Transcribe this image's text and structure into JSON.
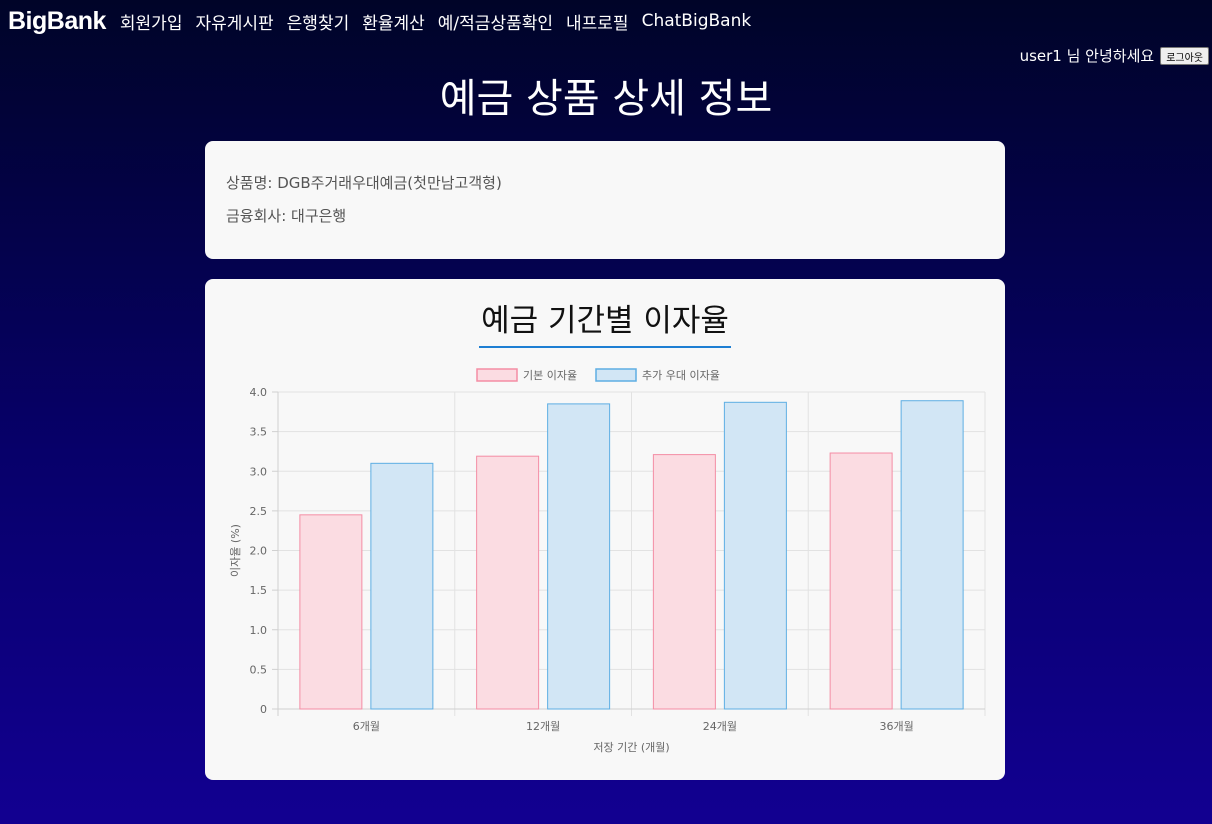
{
  "nav": {
    "logo": "BigBank",
    "items": [
      "회원가입",
      "자유게시판",
      "은행찾기",
      "환율계산",
      "예/적금상품확인",
      "내프로필",
      "ChatBigBank"
    ]
  },
  "user": {
    "greeting": "user1 님 안녕하세요",
    "logout_label": "로그아웃"
  },
  "page_title": "예금 상품 상세 정보",
  "product": {
    "name_line": "상품명: DGB주거래우대예금(첫만남고객형)",
    "company_line": "금융회사: 대구은행"
  },
  "chart_section_title": "예금 기간별 이자율",
  "chart_data": {
    "type": "bar",
    "categories": [
      "6개월",
      "12개월",
      "24개월",
      "36개월"
    ],
    "series": [
      {
        "name": "기본 이자율",
        "values": [
          2.45,
          3.19,
          3.21,
          3.23
        ],
        "fill": "#fbdce2",
        "stroke": "#f48da4"
      },
      {
        "name": "추가 우대 이자율",
        "values": [
          3.1,
          3.85,
          3.87,
          3.89
        ],
        "fill": "#d2e6f5",
        "stroke": "#5eaee3"
      }
    ],
    "xlabel": "저장 기간 (개월)",
    "ylabel": "이자율 (%)",
    "ylim": [
      0,
      4.0
    ],
    "yticks": [
      "0",
      "0.5",
      "1.0",
      "1.5",
      "2.0",
      "2.5",
      "3.0",
      "3.5",
      "4.0"
    ],
    "grid": true,
    "legend": "top"
  }
}
